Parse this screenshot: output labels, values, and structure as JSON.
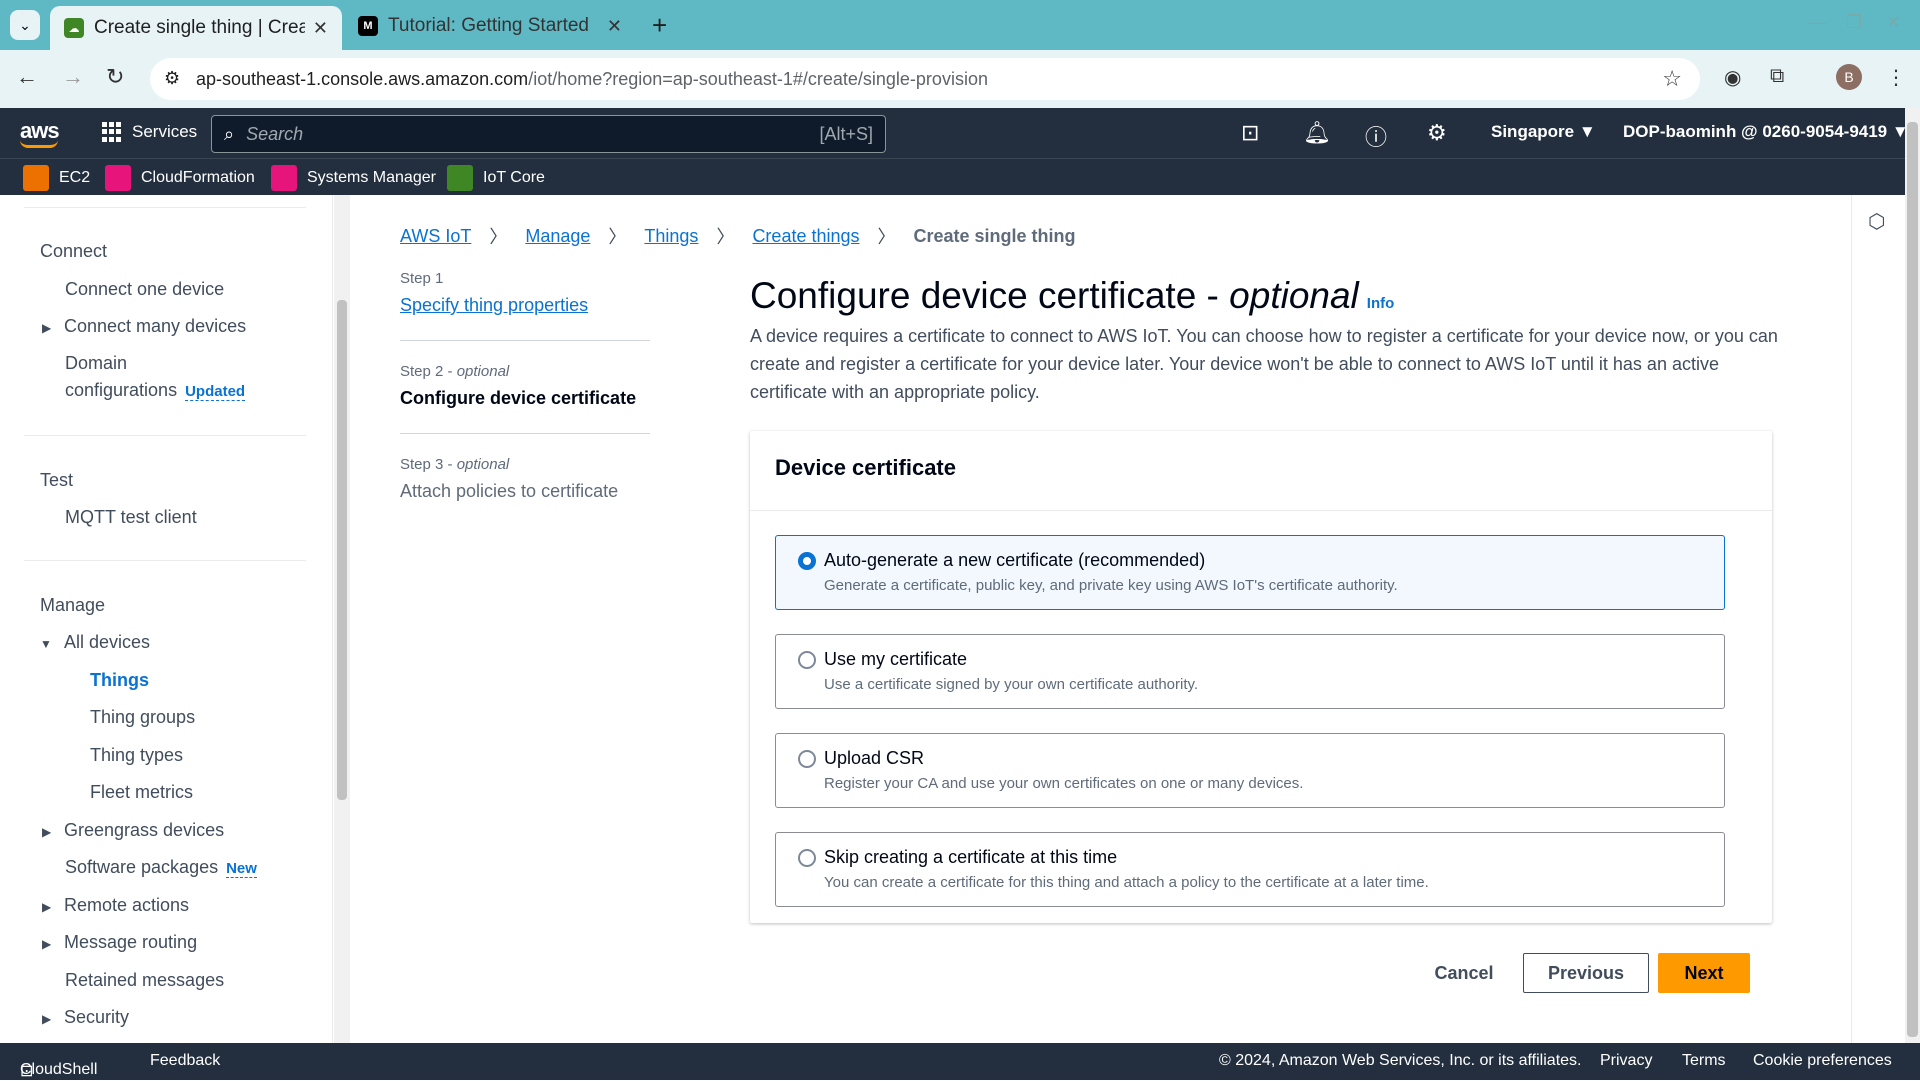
{
  "browser": {
    "tabs": [
      {
        "title": "Create single thing | Crea"
      },
      {
        "title": "Tutorial: Getting Started"
      }
    ],
    "url_host": "ap-southeast-1.console.aws.amazon.com",
    "url_path": "/iot/home?region=ap-southeast-1#/create/single-provision",
    "avatar_letter": "B"
  },
  "aws_header": {
    "logo": "aws",
    "services_label": "Services",
    "search_placeholder": "Search",
    "search_shortcut": "[Alt+S]",
    "region": "Singapore ▼",
    "account": "DOP-baominh @ 0260-9054-9419 ▼",
    "favorites": [
      {
        "label": "EC2",
        "color": "#ed7100"
      },
      {
        "label": "CloudFormation",
        "color": "#e7157b"
      },
      {
        "label": "Systems Manager",
        "color": "#e7157b"
      },
      {
        "label": "IoT Core",
        "color": "#3f8624"
      }
    ]
  },
  "sidebar": {
    "connect": {
      "heading": "Connect",
      "items": [
        "Connect one device",
        "Connect many devices",
        "Domain",
        "configurations"
      ],
      "updated_badge": "Updated"
    },
    "test": {
      "heading": "Test",
      "items": [
        "MQTT test client"
      ]
    },
    "manage": {
      "heading": "Manage",
      "items": [
        "All devices",
        "Things",
        "Thing groups",
        "Thing types",
        "Fleet metrics",
        "Greengrass devices",
        "Software packages",
        "Remote actions",
        "Message routing",
        "Retained messages",
        "Security"
      ],
      "new_badge": "New"
    }
  },
  "breadcrumb": [
    "AWS IoT",
    "Manage",
    "Things",
    "Create things",
    "Create single thing"
  ],
  "steps": [
    {
      "label": "Step 1",
      "name": "Specify thing properties"
    },
    {
      "label": "Step 2 - ",
      "optional": "optional",
      "name": "Configure device certificate"
    },
    {
      "label": "Step 3 - ",
      "optional": "optional",
      "name": "Attach policies to certificate"
    }
  ],
  "page": {
    "title": "Configure device certificate - ",
    "title_optional": "optional",
    "info": "Info",
    "description": "A device requires a certificate to connect to AWS IoT. You can choose how to register a certificate for your device now, or you can create and register a certificate for your device later. Your device won't be able to connect to AWS IoT until it has an active certificate with an appropriate policy."
  },
  "card": {
    "heading": "Device certificate",
    "options": [
      {
        "title": "Auto-generate a new certificate (recommended)",
        "desc": "Generate a certificate, public key, and private key using AWS IoT's certificate authority.",
        "selected": true
      },
      {
        "title": "Use my certificate",
        "desc": "Use a certificate signed by your own certificate authority.",
        "selected": false
      },
      {
        "title": "Upload CSR",
        "desc": "Register your CA and use your own certificates on one or many devices.",
        "selected": false
      },
      {
        "title": "Skip creating a certificate at this time",
        "desc": "You can create a certificate for this thing and attach a policy to the certificate at a later time.",
        "selected": false
      }
    ]
  },
  "buttons": {
    "cancel": "Cancel",
    "previous": "Previous",
    "next": "Next"
  },
  "footer": {
    "cloudshell": "CloudShell",
    "feedback": "Feedback",
    "copyright": "© 2024, Amazon Web Services, Inc. or its affiliates.",
    "privacy": "Privacy",
    "terms": "Terms",
    "cookie": "Cookie preferences"
  }
}
